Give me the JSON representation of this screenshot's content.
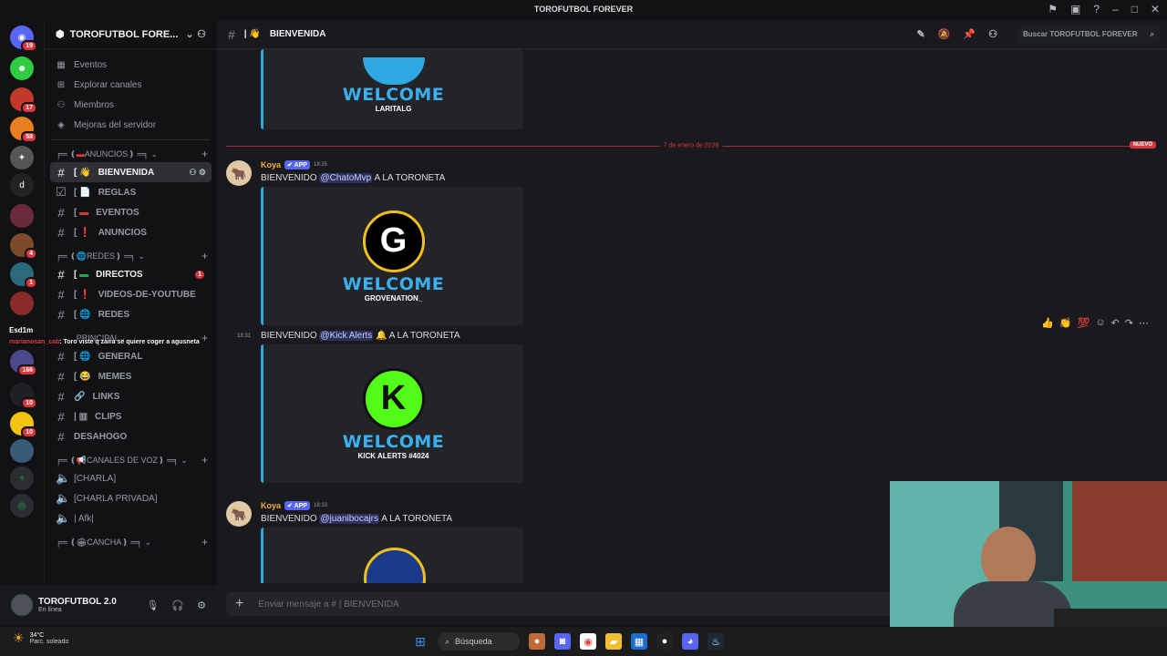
{
  "window": {
    "title": "TOROFUTBOL FOREVER"
  },
  "server": {
    "name": "TOROFUTBOL FORE...",
    "menu": [
      {
        "label": "Eventos",
        "icon": "calendar-icon"
      },
      {
        "label": "Explorar canales",
        "icon": "compass-icon"
      },
      {
        "label": "Miembros",
        "icon": "members-icon"
      },
      {
        "label": "Mejoras del servidor",
        "icon": "boost-icon"
      }
    ]
  },
  "categories": {
    "anuncios": "ANUNCIOS",
    "redes": "REDES",
    "principal": "PRINCIPAL",
    "voz": "CANALES DE VOZ",
    "cancha": "CANCHA"
  },
  "channels": {
    "bienvenida": "BIENVENIDA",
    "reglas": "REGLAS",
    "eventos": "EVENTOS",
    "anuncios": "ANUNCIOS",
    "directos": "DIRECTOS",
    "directos_unread": "1",
    "videos": "VIDEOS-DE-YOUTUBE",
    "redes": "REDES",
    "general": "GENERAL",
    "memes": "MEMES",
    "links": "LINKS",
    "clips": "CLIPS",
    "desahogo": "DESAHOGO",
    "charla": "[CHARLA]",
    "charla_privada": "[CHARLA PRIVADA]",
    "afk": "| Afk|"
  },
  "user": {
    "name": "TOROFUTBOL 2.0",
    "status": "En línea"
  },
  "header": {
    "channel": "BIENVENIDA",
    "search_placeholder": "Buscar TOROFUTBOL FOREVER"
  },
  "messages": {
    "top_embed": {
      "welcome": "WELCOME",
      "name": "LARITALG"
    },
    "divider": {
      "date": "7 de enero de 2026",
      "new_label": "NUEVO"
    },
    "m1": {
      "author": "Koya",
      "app": "APP",
      "time": "18:25",
      "prefix": "BIENVENIDO",
      "mention": "@ChatoMvp",
      "suffix": "A LA TORONETA",
      "welcome": "WELCOME",
      "name": "GROVENATION_"
    },
    "m2": {
      "time": "18:31",
      "prefix": "BIENVENIDO",
      "mention": "@Kick Alerts",
      "suffix": "A LA TORONETA",
      "welcome": "WELCOME",
      "name": "KICK ALERTS #4024"
    },
    "m3": {
      "author": "Koya",
      "app": "APP",
      "time": "18:33",
      "prefix": "BIENVENIDO",
      "mention": "@juanibocajrs",
      "suffix": "A LA TORONETA"
    }
  },
  "input": {
    "placeholder": "Enviar mensaje a # | BIENVENIDA"
  },
  "overlay": {
    "user": "marianosan_cab",
    "text": ": Toro viste q zaira se quiere coger a agusneta"
  },
  "guild_badges": [
    "19",
    "17",
    "58",
    "4",
    "1",
    "166",
    "10",
    "10"
  ],
  "guild_label": "Esd1m",
  "taskbar": {
    "temp": "34°C",
    "weather": "Parc. soleado",
    "search": "Búsqueda"
  },
  "colors": {
    "accent": "#5865f2",
    "embed_border": "#2fa8e1",
    "unread": "#da373c",
    "author": "#f0b232"
  }
}
